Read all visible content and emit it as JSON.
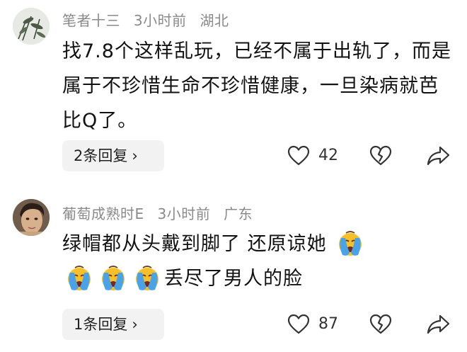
{
  "comments": [
    {
      "username": "笔者十三",
      "time": "3小时前",
      "location": "湖北",
      "text": "找7.8个这样乱玩，已经不属于出轨了，而是属于不珍惜生命不珍惜健康，一旦染病就芭比Q了。",
      "replies_label": "2条回复",
      "likes": "42"
    },
    {
      "username": "葡萄成熟时E",
      "time": "3小时前",
      "location": "广东",
      "text_line1": "绿帽都从头戴到脚了 还原谅她",
      "text_line2": "丢尽了男人的脸",
      "replies_label": "1条回复",
      "likes": "87"
    }
  ],
  "icons": {
    "like": "heart-outline-icon",
    "dislike": "broken-heart-icon",
    "share": "share-arrow-icon",
    "reply_chevron": "chevron-right-icon",
    "emoji": "crying-face-emoji"
  },
  "colors": {
    "meta_text": "#8a8a8a",
    "reply_pill_bg": "#f2f2f2",
    "icon_stroke": "#333333",
    "emoji_face": "#f7c02a",
    "emoji_tear": "#4aa3e8"
  }
}
